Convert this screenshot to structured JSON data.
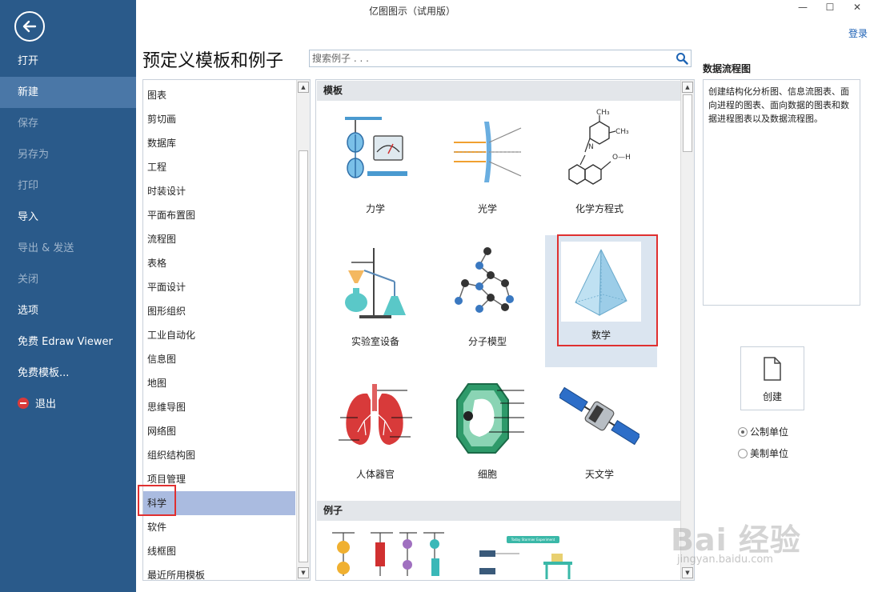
{
  "window": {
    "title": "亿图图示（试用版）",
    "minimize": "—",
    "maximize": "☐",
    "close": "✕",
    "login": "登录"
  },
  "nav": {
    "items": [
      {
        "label": "打开",
        "state": "normal"
      },
      {
        "label": "新建",
        "state": "active"
      },
      {
        "label": "保存",
        "state": "disabled"
      },
      {
        "label": "另存为",
        "state": "disabled"
      },
      {
        "label": "打印",
        "state": "disabled"
      },
      {
        "label": "导入",
        "state": "normal"
      },
      {
        "label": "导出 & 发送",
        "state": "disabled"
      },
      {
        "label": "关闭",
        "state": "disabled"
      },
      {
        "label": "选项",
        "state": "normal"
      },
      {
        "label": "免费 Edraw Viewer",
        "state": "normal"
      },
      {
        "label": "免费模板...",
        "state": "normal"
      },
      {
        "label": "退出",
        "state": "normal"
      }
    ]
  },
  "main": {
    "heading": "预定义模板和例子",
    "search": {
      "placeholder": "搜索例子 . . ."
    }
  },
  "categories": {
    "items": [
      "图表",
      "剪切画",
      "数据库",
      "工程",
      "时装设计",
      "平面布置图",
      "流程图",
      "表格",
      "平面设计",
      "图形组织",
      "工业自动化",
      "信息图",
      "地图",
      "思维导图",
      "网络图",
      "组织结构图",
      "项目管理",
      "科学",
      "软件",
      "线框图",
      "最近所用模板"
    ],
    "selected": "科学"
  },
  "gallery": {
    "templates_header": "模板",
    "examples_header": "例子",
    "templates": [
      {
        "label": "力学",
        "icon": "mechanics-icon"
      },
      {
        "label": "光学",
        "icon": "optics-icon"
      },
      {
        "label": "化学方程式",
        "icon": "chemical-equation-icon"
      },
      {
        "label": "实验室设备",
        "icon": "lab-equipment-icon"
      },
      {
        "label": "分子模型",
        "icon": "molecule-model-icon"
      },
      {
        "label": "数学",
        "icon": "pyramid-icon"
      },
      {
        "label": "人体器官",
        "icon": "lungs-icon"
      },
      {
        "label": "细胞",
        "icon": "cell-icon"
      },
      {
        "label": "天文学",
        "icon": "satellite-icon"
      }
    ],
    "selected": "数学",
    "chem_labels": {
      "ch3": "CH₃",
      "oh": "O—H",
      "n": "N"
    },
    "example_card_title": "Today Stormier Experiment"
  },
  "preview": {
    "title": "数据流程图",
    "description": "创建结构化分析图、信息流图表、面向进程的图表、面向数据的图表和数据进程图表以及数据流程图。",
    "create_label": "创建",
    "units": [
      {
        "label": "公制单位",
        "checked": true
      },
      {
        "label": "美制单位",
        "checked": false
      }
    ]
  },
  "watermark": {
    "line1": "Bai 经验",
    "line2": "jingyan.baidu.com"
  },
  "colors": {
    "nav_bg": "#2a5a8a",
    "nav_active": "#4a77a7",
    "selected_category": "#aabbe0",
    "selected_tile": "#dbe5f0",
    "highlight_box": "#e03030",
    "link": "#1a5fb4"
  }
}
